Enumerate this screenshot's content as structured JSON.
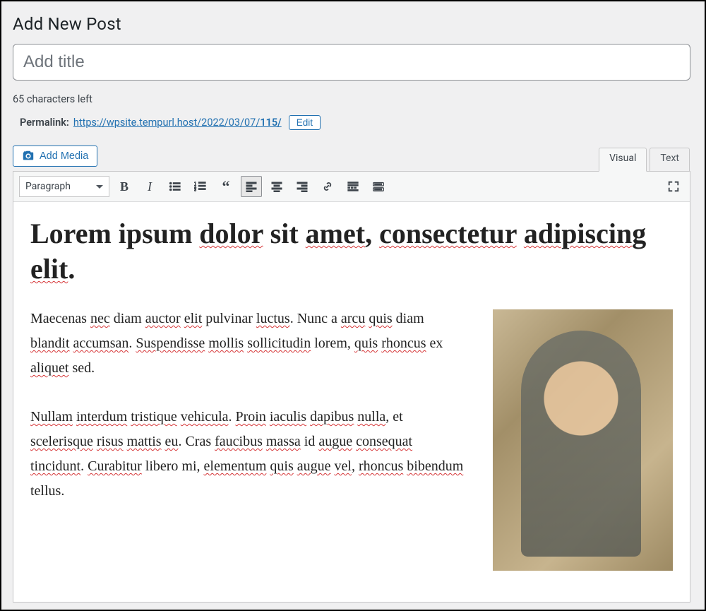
{
  "page": {
    "title_text": "Add New Post"
  },
  "title_field": {
    "placeholder": "Add title",
    "value": ""
  },
  "char_counter": {
    "text": "65 characters left"
  },
  "permalink": {
    "label": "Permalink:",
    "url_text": "https://wpsite.tempurl.host/2022/03/07/",
    "slug": "115/",
    "edit_label": "Edit"
  },
  "media_button": {
    "label": "Add Media"
  },
  "editor_tabs": {
    "visual": "Visual",
    "text": "Text",
    "active": "visual"
  },
  "toolbar": {
    "format_selected": "Paragraph",
    "buttons": {
      "bold": "B",
      "italic": "I",
      "ul": "bulleted list",
      "ol": "numbered list",
      "quote": "blockquote",
      "align_left": "align left",
      "align_center": "align center",
      "align_right": "align right",
      "link": "insert link",
      "more": "read more",
      "toggle": "toolbar toggle",
      "fullscreen": "fullscreen"
    }
  },
  "content": {
    "heading": "Lorem ipsum dolor sit amet, consectetur adipiscing elit.",
    "para1": "Maecenas nec diam auctor elit pulvinar luctus. Nunc a arcu quis diam blandit accumsan. Suspendisse mollis sollicitudin lorem, quis rhoncus ex aliquet sed.",
    "para2": "Nullam interdum tristique vehicula. Proin iaculis dapibus nulla, et scelerisque risus mattis eu. Cras faucibus massa id augue consequat tincidunt. Curabitur libero mi, elementum quis augue vel, rhoncus bibendum tellus."
  }
}
